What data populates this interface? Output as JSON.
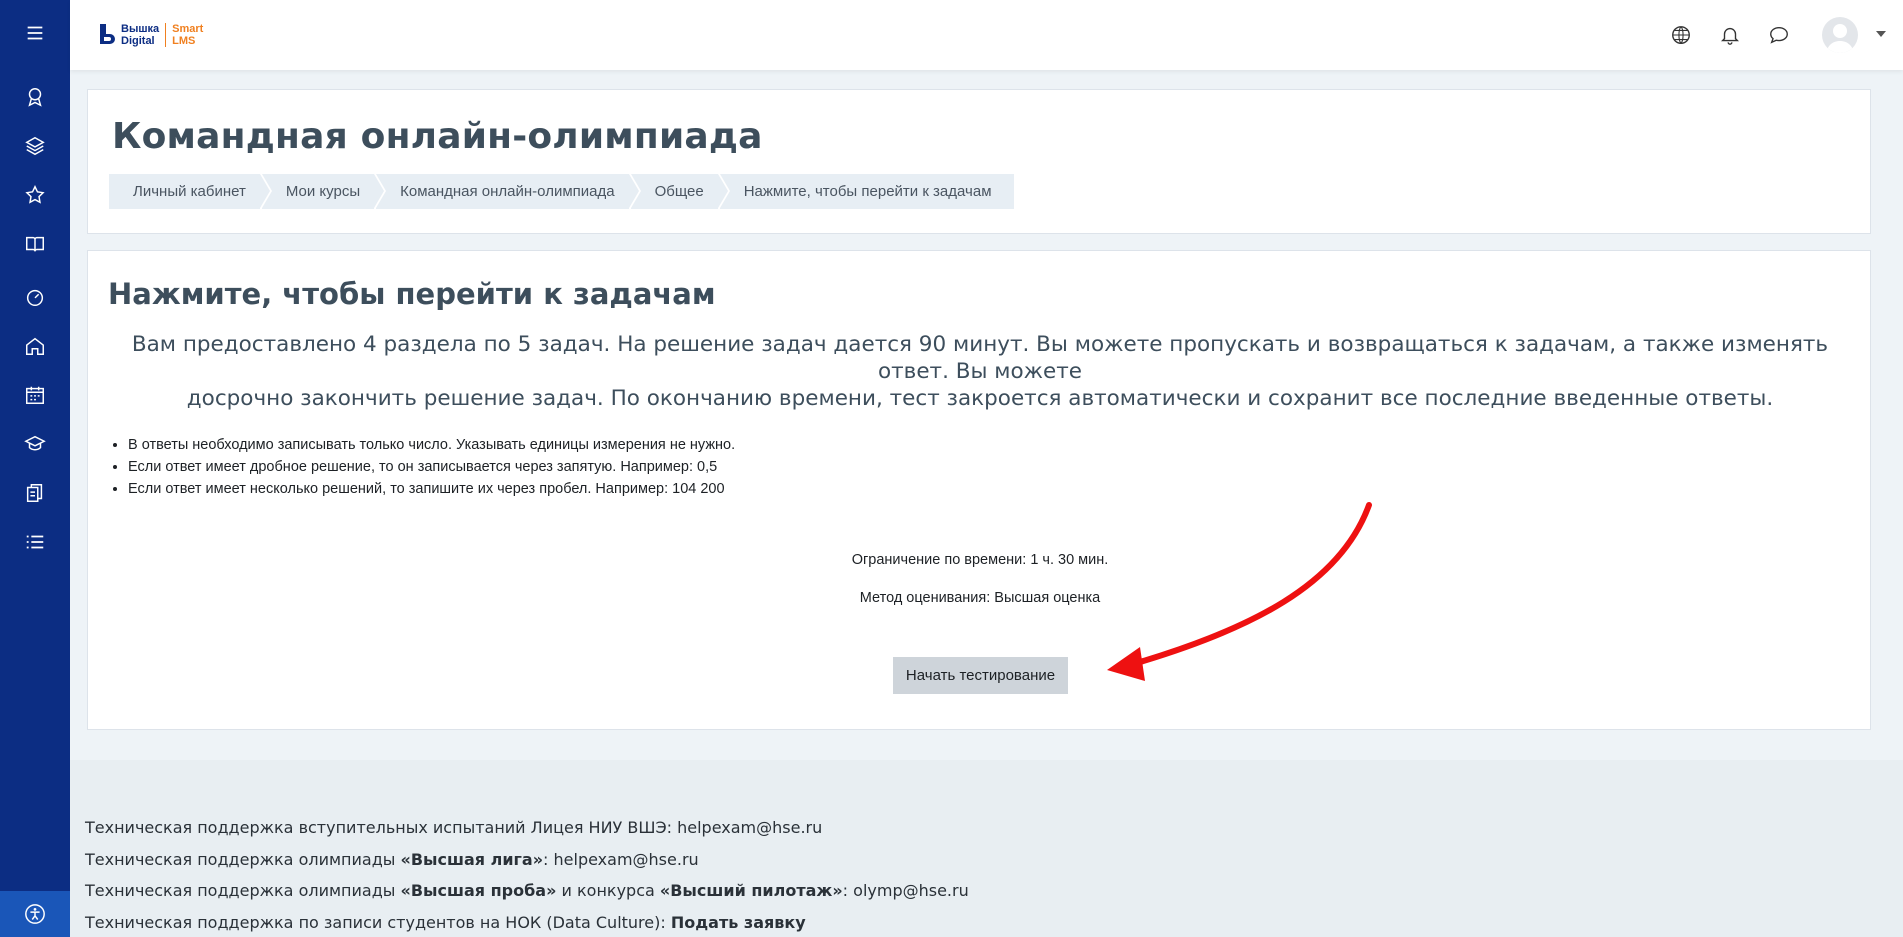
{
  "brand": {
    "name_line1": "Вышка",
    "name_line2": "Digital",
    "product_line1": "Smart",
    "product_line2": "LMS"
  },
  "sidebar": {
    "items": [
      {
        "icon": "award-icon"
      },
      {
        "icon": "layers-icon"
      },
      {
        "icon": "star-icon"
      },
      {
        "icon": "book-icon"
      },
      {
        "icon": "dashboard-icon"
      },
      {
        "icon": "home-icon"
      },
      {
        "icon": "calendar-icon"
      },
      {
        "icon": "graduation-cap-icon"
      },
      {
        "icon": "files-icon"
      },
      {
        "icon": "list-icon"
      }
    ],
    "bottom_icon": "accessibility-icon"
  },
  "navbar": {
    "icons": [
      "globe-icon",
      "bell-icon",
      "chat-icon"
    ]
  },
  "header": {
    "title": "Командная онлайн-олимпиада",
    "breadcrumb": [
      "Личный кабинет",
      "Мои курсы",
      "Командная онлайн-олимпиада",
      "Общее",
      "Нажмите, чтобы перейти к задачам"
    ]
  },
  "main": {
    "section_title": "Нажмите, чтобы перейти к задачам",
    "intro_line1": "Вам предоставлено 4 раздела по 5 задач. На решение задач дается 90 минут. Вы можете пропускать и возвращаться к задачам, а также изменять ответ. Вы можете",
    "intro_line2": "досрочно закончить решение задач. По окончанию времени, тест закроется автоматически и сохранит все последние введенные ответы.",
    "rules": [
      "В ответы необходимо записывать только число. Указывать единицы измерения не нужно.",
      "Если ответ имеет дробное решение, то он записывается через запятую. Например: 0,5",
      "Если ответ имеет несколько решений, то запишите их через пробел. Например: 104 200"
    ],
    "time_limit": "Ограничение по времени: 1 ч. 30 мин.",
    "grading_method": "Метод оценивания: Высшая оценка",
    "start_button": "Начать тестирование"
  },
  "footer": {
    "line1_text": "Техническая поддержка вступительных испытаний Лицея НИУ ВШЭ: helpexam@hse.ru",
    "line2_prefix": "Техническая поддержка олимпиады ",
    "line2_bold": "«Высшая лига»",
    "line2_suffix": ": helpexam@hse.ru",
    "line3_prefix": "Техническая поддержка олимпиады ",
    "line3_bold1": "«Высшая проба»",
    "line3_mid": " и конкурса ",
    "line3_bold2": "«Высший пилотаж»",
    "line3_suffix": ": olymp@hse.ru",
    "line4_prefix": "Техническая поддержка по записи студентов на НОК (Data Culture): ",
    "line4_link": "Подать заявку"
  },
  "colors": {
    "sidebar": "#0c2d83",
    "sidebar_bottom": "#1a56b8",
    "accent_orange": "#f08020",
    "arrow_red": "#ee1111"
  }
}
